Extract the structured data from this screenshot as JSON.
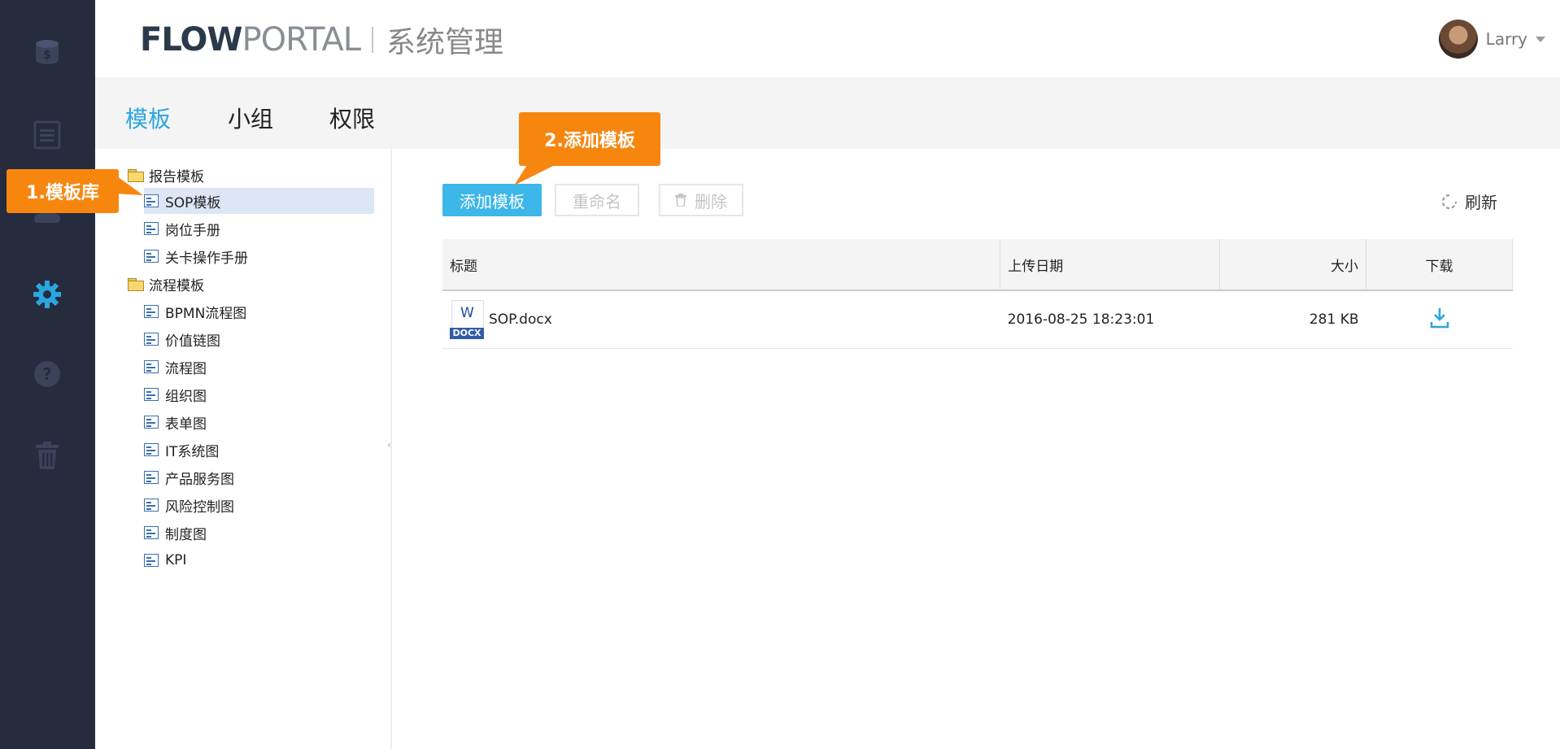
{
  "rail": {
    "icons": [
      "coins-icon",
      "list-icon",
      "cloud-icon",
      "gear-icon",
      "help-icon",
      "trash-icon"
    ]
  },
  "header": {
    "logo_flow": "FLOW",
    "logo_portal": "PORTAL",
    "subtitle": "系统管理",
    "user_name": "Larry"
  },
  "tabs": [
    {
      "label": "模板",
      "active": true
    },
    {
      "label": "小组",
      "active": false
    },
    {
      "label": "权限",
      "active": false
    }
  ],
  "tree": {
    "groups": [
      {
        "label": "报告模板",
        "items": [
          "SOP模板",
          "岗位手册",
          "关卡操作手册"
        ]
      },
      {
        "label": "流程模板",
        "items": [
          "BPMN流程图",
          "价值链图",
          "流程图",
          "组织图",
          "表单图",
          "IT系统图",
          "产品服务图",
          "风险控制图",
          "制度图",
          "KPI"
        ]
      }
    ],
    "selected": "SOP模板"
  },
  "toolbar": {
    "add_label": "添加模板",
    "rename_label": "重命名",
    "delete_label": "删除",
    "refresh_label": "刷新"
  },
  "table": {
    "columns": [
      "标题",
      "上传日期",
      "大小",
      "下载"
    ],
    "rows": [
      {
        "title": "SOP.docx",
        "date": "2016-08-25 18:23:01",
        "size": "281 KB",
        "icon_letter": "W",
        "icon_tag": "DOCX"
      }
    ]
  },
  "callouts": {
    "library": "1.模板库",
    "add": "2.添加模板"
  },
  "colors": {
    "accent": "#2aa6e0",
    "rail": "#262b3e",
    "callout": "#f7860f"
  }
}
